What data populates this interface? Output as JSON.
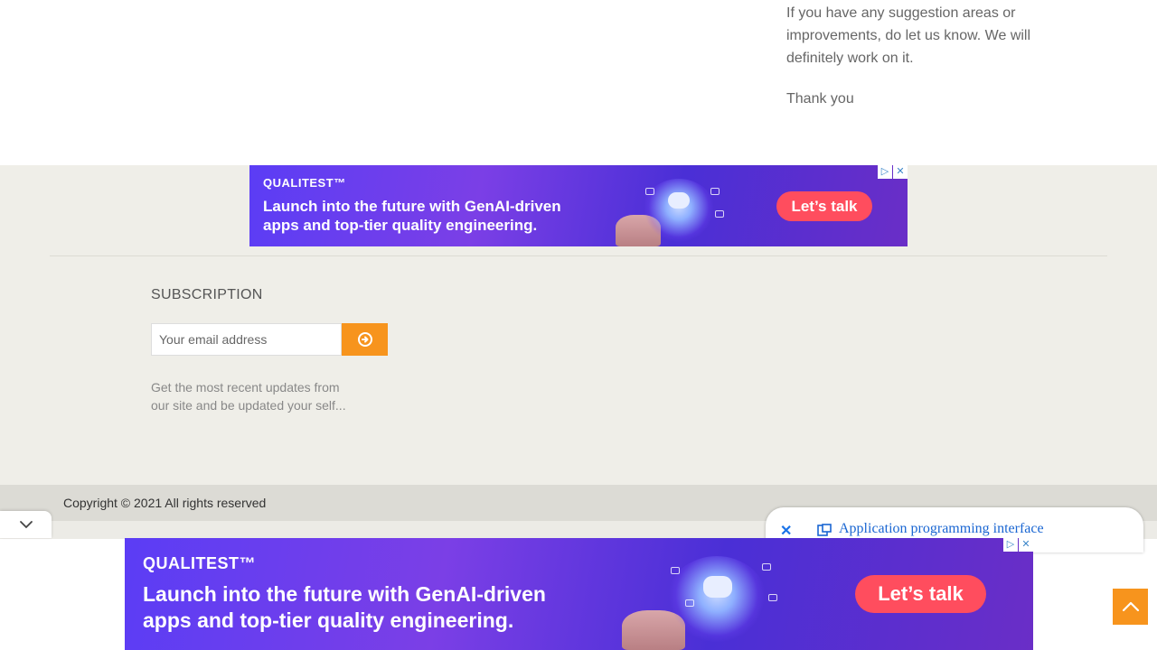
{
  "article": {
    "paragraph": "If you have any suggestion areas or improvements, do let us know. We will definitely work on it.",
    "closing": "Thank you"
  },
  "ads": {
    "top": {
      "brand": "QUALITEST™",
      "headline_line1": "Launch into the future with GenAI-driven",
      "headline_line2": "apps and top-tier quality engineering.",
      "cta": "Let’s talk"
    },
    "bottom": {
      "brand": "QUALITEST™",
      "headline_line1": "Launch into the future with GenAI-driven",
      "headline_line2": "apps and top-tier quality engineering.",
      "cta": "Let’s talk"
    },
    "adchoices_icon": "adchoices-icon",
    "close_icon": "close-icon"
  },
  "subscription": {
    "title": "SUBSCRIPTION",
    "email_placeholder": "Your email address",
    "submit_icon": "arrow-circle-right-icon",
    "description": "Get the most recent updates from our site and be updated your self..."
  },
  "footer": {
    "copyright": "Copyright © 2021 All rights reserved"
  },
  "suggestion": {
    "link": "Application programming interface",
    "close_icon": "close-icon",
    "link_icon": "external-link-icon"
  },
  "controls": {
    "collapse_icon": "chevron-down-icon",
    "back_to_top_icon": "chevron-up-icon"
  },
  "colors": {
    "accent_orange": "#f7941d",
    "footer_bg": "#efeee8",
    "copyright_bg": "#dcdbd5",
    "ad_cta": "#ff4d5e",
    "link_blue": "#1a66d2"
  }
}
